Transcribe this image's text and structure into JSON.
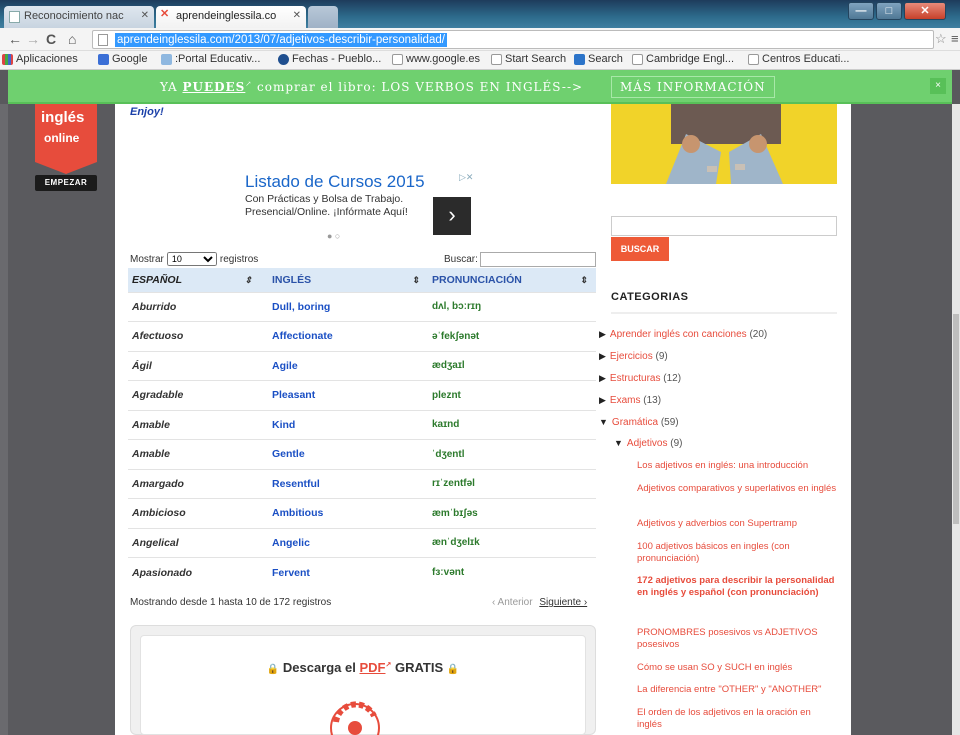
{
  "browser": {
    "tabs": [
      {
        "label": "Reconocimiento nac",
        "active": false
      },
      {
        "label": "aprendeinglessila.co",
        "active": true
      }
    ],
    "url": "aprendeinglessila.com/2013/07/adjetivos-describir-personalidad/",
    "bookmarks": [
      {
        "label": "Aplicaciones",
        "icon": "apps-grid-icon"
      },
      {
        "label": "Google",
        "icon": "google-icon"
      },
      {
        "label": ":Portal Educativ...",
        "icon": "portal-icon"
      },
      {
        "label": "Fechas - Pueblo...",
        "icon": "globe-icon"
      },
      {
        "label": "www.google.es",
        "icon": "page-icon"
      },
      {
        "label": "Start Search",
        "icon": "page-icon"
      },
      {
        "label": "Search",
        "icon": "search-icon"
      },
      {
        "label": "Cambridge Engl...",
        "icon": "page-icon"
      },
      {
        "label": "Centros Educati...",
        "icon": "page-icon"
      }
    ]
  },
  "promo": {
    "prefix": "YA",
    "highlight": "PUEDES",
    "text": "comprar el libro: LOS VERBOS EN INGLÉS-->",
    "button": "MÁS INFORMACIÓN",
    "close": "×"
  },
  "badge": {
    "line1": "inglés",
    "line2": "online",
    "button": "EMPEZAR"
  },
  "enjoy": "Enjoy!",
  "ad": {
    "title": "Listado de Cursos 2015",
    "line1": "Con Prácticas y Bolsa de Trabajo.",
    "line2": "Presencial/Online. ¡Infórmate Aquí!",
    "arrow": "›",
    "dots": "● ○",
    "choices": "▷✕"
  },
  "table": {
    "show_label": "Mostrar",
    "show_value": "10",
    "records_label": "registros",
    "search_label": "Buscar:",
    "headers": [
      "ESPAÑOL",
      "INGLÉS",
      "PRONUNCIACIÓN"
    ],
    "sort_glyph": "⇕",
    "rows": [
      [
        "Aburrido",
        "Dull, boring",
        "dʌl, bɔːrɪŋ"
      ],
      [
        "Afectuoso",
        "Affectionate",
        "əˈfekʃənət"
      ],
      [
        "Ágil",
        "Agile",
        "ædʒaɪl"
      ],
      [
        "Agradable",
        "Pleasant",
        "pleznt"
      ],
      [
        "Amable",
        "Kind",
        "kaɪnd"
      ],
      [
        "Amable",
        "Gentle",
        "ˈdʒentl"
      ],
      [
        "Amargado",
        "Resentful",
        "rɪˈzentfəl"
      ],
      [
        "Ambicioso",
        "Ambitious",
        "æmˈbɪʃəs"
      ],
      [
        "Angelical",
        "Angelic",
        "ænˈdʒelɪk"
      ],
      [
        "Apasionado",
        "Fervent",
        "fɜːvənt"
      ]
    ],
    "info": "Mostrando desde 1 hasta 10 de 172 registros",
    "prev": "‹ Anterior",
    "next": "Siguiente ›"
  },
  "download": {
    "prefix": "Descarga el",
    "pdf": "PDF",
    "suffix": "GRATIS",
    "lock": "🔒"
  },
  "sidebar": {
    "search_button": "BUSCAR",
    "categories_title": "CATEGORIAS",
    "categories": [
      {
        "label": "Aprender inglés con canciones",
        "count": "(20)",
        "arrow": "▶"
      },
      {
        "label": "Ejercicios",
        "count": "(9)",
        "arrow": "▶"
      },
      {
        "label": "Estructuras",
        "count": "(12)",
        "arrow": "▶"
      },
      {
        "label": "Exams",
        "count": "(13)",
        "arrow": "▶"
      },
      {
        "label": "Gramática",
        "count": "(59)",
        "arrow": "▼"
      }
    ],
    "subcategory": {
      "label": "Adjetivos",
      "count": "(9)",
      "arrow": "▼"
    },
    "posts": [
      "Los adjetivos en inglés: una introducción",
      "Adjetivos comparativos y superlativos en inglés",
      "Adjetivos y adverbios con Supertramp",
      "100 adjetivos básicos en ingles (con pronunciación)",
      "172 adjetivos para describir la personalidad en inglés y español (con pronunciación)",
      "PRONOMBRES posesivos vs ADJETIVOS posesivos",
      "Cómo se usan SO y SUCH en inglés",
      "La diferencia entre \"OTHER\" y \"ANOTHER\"",
      "El orden de los adjetivos en la oración en inglés"
    ]
  }
}
